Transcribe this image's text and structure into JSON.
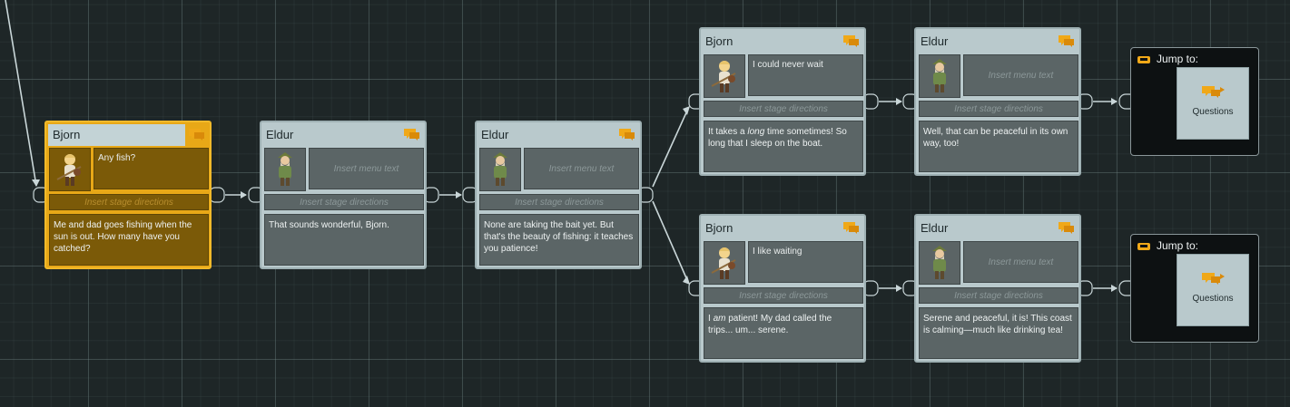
{
  "nodes": [
    {
      "speaker": "Bjorn",
      "menu_text": "Any fish?",
      "stage_placeholder": "Insert stage directions",
      "text": "Me and dad goes fishing when the sun is out. How many have you catched?",
      "portrait": "bjorn-portrait",
      "selected": true
    },
    {
      "speaker": "Eldur",
      "menu_placeholder": "Insert menu text",
      "stage_placeholder": "Insert stage directions",
      "text": "That sounds wonderful, Bjorn.",
      "portrait": "eldur-portrait"
    },
    {
      "speaker": "Eldur",
      "menu_placeholder": "Insert menu text",
      "stage_placeholder": "Insert stage directions",
      "text": "None are taking the bait yet. But that's the beauty of fishing: it teaches you patience!",
      "portrait": "eldur-portrait"
    },
    {
      "speaker": "Bjorn",
      "menu_text": "I could never wait",
      "stage_placeholder": "Insert stage directions",
      "text_before": "It takes a ",
      "text_em": "long",
      "text_after": " time sometimes! So long that I sleep on the boat.",
      "portrait": "bjorn-portrait"
    },
    {
      "speaker": "Eldur",
      "menu_placeholder": "Insert menu text",
      "stage_placeholder": "Insert stage directions",
      "text": "Well, that can be peaceful in its own way, too!",
      "portrait": "eldur-portrait"
    },
    {
      "speaker": "Bjorn",
      "menu_text": "I like waiting",
      "stage_placeholder": "Insert stage directions",
      "text_before": "I ",
      "text_em": "am",
      "text_after": " patient! My dad called the trips... um... serene.",
      "portrait": "bjorn-portrait"
    },
    {
      "speaker": "Eldur",
      "menu_placeholder": "Insert menu text",
      "stage_placeholder": "Insert stage directions",
      "text": "Serene and peaceful, it is! This coast is calming—much like drinking tea!",
      "portrait": "eldur-portrait"
    }
  ],
  "jumps": [
    {
      "label": "Jump to:",
      "target": "Questions"
    },
    {
      "label": "Jump to:",
      "target": "Questions"
    }
  ],
  "colors": {
    "canvas": "#1e2627",
    "node": "#b9c9cc",
    "selected": "#e8a817",
    "field": "#5b6566",
    "wire": "#c9d6d8",
    "icon": "#f0a818"
  },
  "icons": [
    "speech-bubble-icon",
    "jump-arrow-icon",
    "bjorn-portrait",
    "eldur-portrait"
  ]
}
